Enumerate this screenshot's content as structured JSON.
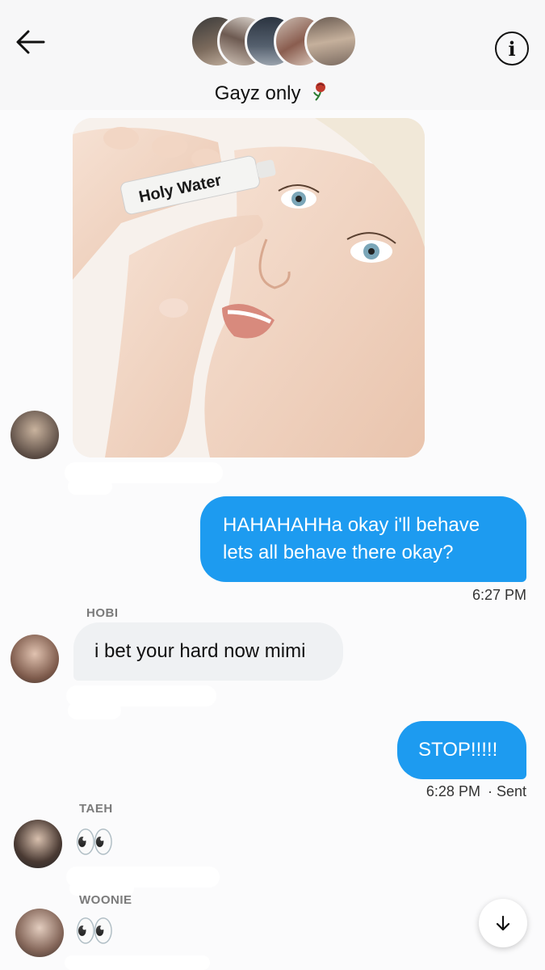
{
  "header": {
    "title": "Gayz only",
    "title_emoji": "rose-icon",
    "avatar_count": 5
  },
  "messages": [
    {
      "type": "image",
      "direction": "incoming",
      "image_text": "Holy Water"
    },
    {
      "type": "text",
      "direction": "outgoing",
      "line1": "HAHAHAHHa okay i'll behave",
      "line2": "lets all behave there okay?",
      "time": "6:27 PM"
    },
    {
      "type": "text",
      "direction": "incoming",
      "sender": "HOBI",
      "text": "i bet your hard now mimi"
    },
    {
      "type": "text",
      "direction": "outgoing",
      "text": "STOP!!!!!",
      "time": "6:28 PM",
      "status": "· Sent"
    },
    {
      "type": "emoji",
      "direction": "incoming",
      "sender": "TAEH",
      "text": "👀"
    },
    {
      "type": "emoji",
      "direction": "incoming",
      "sender": "WOONIE",
      "text": "👀"
    }
  ],
  "colors": {
    "outgoing_bubble": "#1d9bf0",
    "incoming_bubble": "#eff1f3",
    "background": "#fbfbfc"
  },
  "icons": {
    "back": "arrow-left-icon",
    "info": "info-icon",
    "scroll": "arrow-down-icon"
  }
}
